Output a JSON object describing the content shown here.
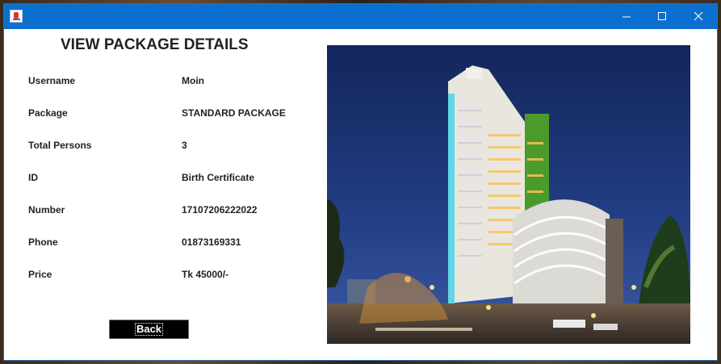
{
  "window": {
    "controls": {
      "minimize_icon": "minimize-icon",
      "maximize_icon": "maximize-icon",
      "close_icon": "close-icon"
    }
  },
  "page": {
    "title": "VIEW PACKAGE DETAILS"
  },
  "details": [
    {
      "label": "Username",
      "value": "Moin"
    },
    {
      "label": "Package",
      "value": "STANDARD PACKAGE"
    },
    {
      "label": "Total Persons",
      "value": "3"
    },
    {
      "label": "ID",
      "value": "Birth Certificate"
    },
    {
      "label": "Number",
      "value": "17107206222022"
    },
    {
      "label": "Phone",
      "value": "01873169331"
    },
    {
      "label": "Price",
      "value": "Tk 45000/-"
    }
  ],
  "back_button": {
    "label": "Back"
  },
  "colors": {
    "titlebar": "#0a6fcf",
    "button_bg": "#000000",
    "text": "#222222"
  }
}
